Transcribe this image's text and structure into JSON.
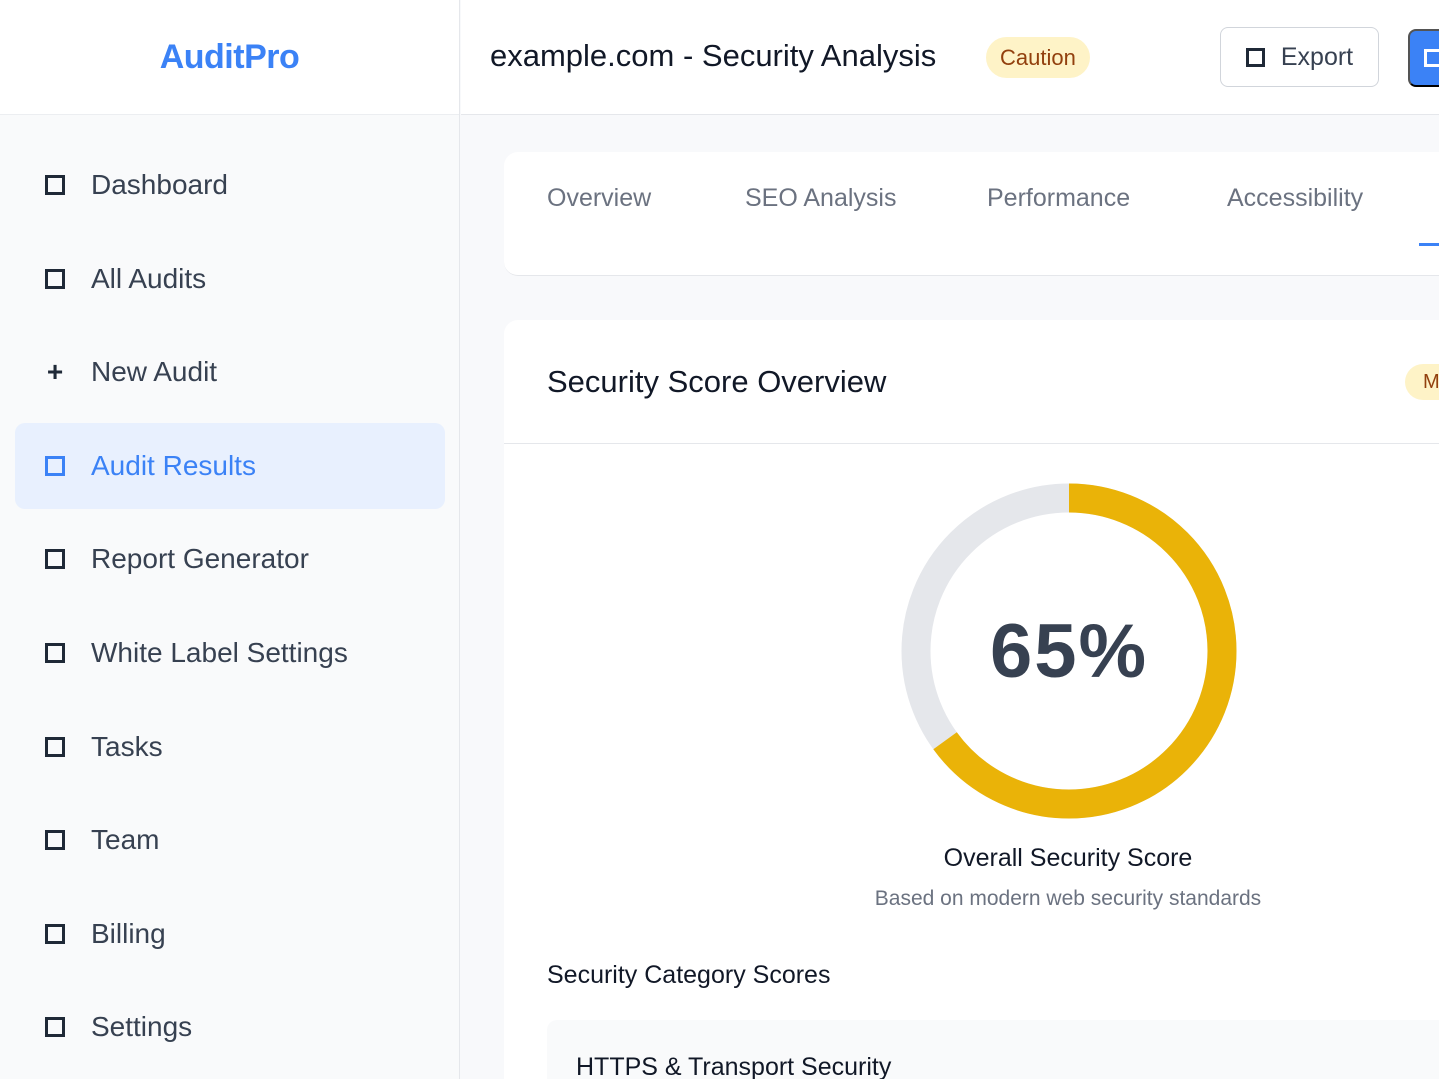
{
  "app": {
    "brand": "AuditPro"
  },
  "sidebar": {
    "items": [
      {
        "label": "Dashboard",
        "icon": "square-icon",
        "active": false
      },
      {
        "label": "All Audits",
        "icon": "square-icon",
        "active": false
      },
      {
        "label": "New Audit",
        "icon": "plus-icon",
        "active": false
      },
      {
        "label": "Audit Results",
        "icon": "square-icon",
        "active": true
      },
      {
        "label": "Report Generator",
        "icon": "square-icon",
        "active": false
      },
      {
        "label": "White Label Settings",
        "icon": "square-icon",
        "active": false
      },
      {
        "label": "Tasks",
        "icon": "square-icon",
        "active": false
      },
      {
        "label": "Team",
        "icon": "square-icon",
        "active": false
      },
      {
        "label": "Billing",
        "icon": "square-icon",
        "active": false
      },
      {
        "label": "Settings",
        "icon": "square-icon",
        "active": false
      }
    ]
  },
  "header": {
    "title": "example.com - Security Analysis",
    "status": "Caution",
    "export_label": "Export"
  },
  "tabs": [
    {
      "label": "Overview"
    },
    {
      "label": "SEO Analysis"
    },
    {
      "label": "Performance"
    },
    {
      "label": "Accessibility"
    }
  ],
  "security": {
    "card_title": "Security Score Overview",
    "card_badge": "M",
    "score": 65,
    "score_text": "65%",
    "score_label": "Overall Security Score",
    "score_sub": "Based on modern web security standards",
    "categories_title": "Security Category Scores",
    "categories": [
      {
        "name": "HTTPS & Transport Security"
      }
    ]
  },
  "colors": {
    "accent": "#3b82f6",
    "gauge_fill": "#eab308",
    "gauge_track": "#e5e7eb",
    "warning_bg": "#fef3c7",
    "warning_text": "#92400e"
  }
}
